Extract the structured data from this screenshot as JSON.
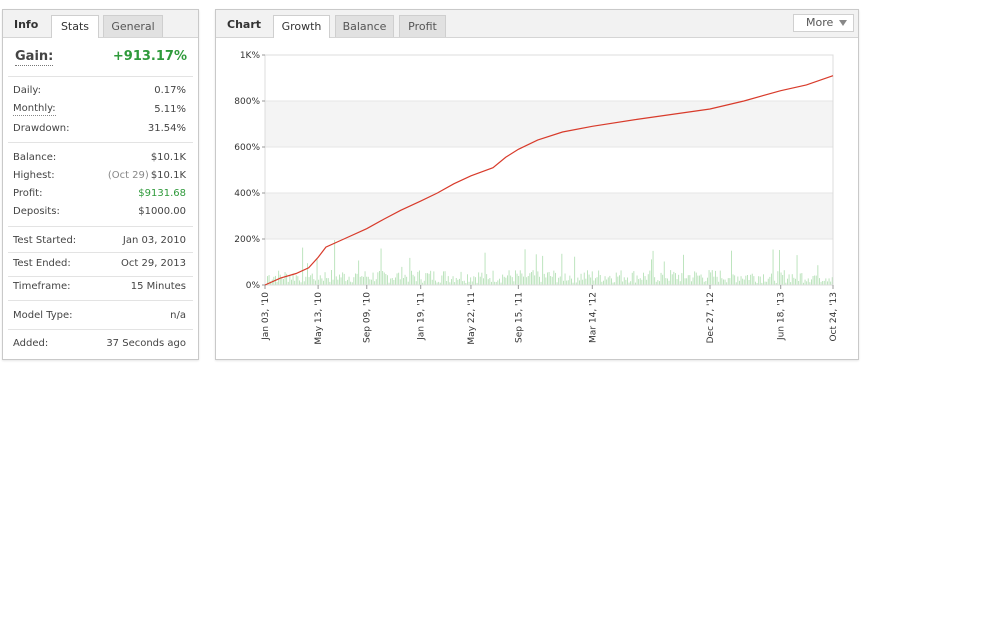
{
  "info": {
    "title": "Info",
    "tabs": [
      {
        "label": "Stats",
        "active": true
      },
      {
        "label": "General",
        "active": false
      }
    ],
    "gain": {
      "label": "Gain:",
      "value": "+913.17%"
    },
    "rows": {
      "daily": {
        "label": "Daily:",
        "value": "0.17%"
      },
      "monthly": {
        "label": "Monthly:",
        "value": "5.11%"
      },
      "drawdown": {
        "label": "Drawdown:",
        "value": "31.54%"
      },
      "balance": {
        "label": "Balance:",
        "value": "$10.1K"
      },
      "highest": {
        "label": "Highest:",
        "date": "(Oct 29)",
        "value": "$10.1K"
      },
      "profit": {
        "label": "Profit:",
        "value": "$9131.68"
      },
      "deposits": {
        "label": "Deposits:",
        "value": "$1000.00"
      },
      "test_started": {
        "label": "Test Started:",
        "value": "Jan 03, 2010"
      },
      "test_ended": {
        "label": "Test Ended:",
        "value": "Oct 29, 2013"
      },
      "timeframe": {
        "label": "Timeframe:",
        "value": "15 Minutes"
      },
      "model_type": {
        "label": "Model Type:",
        "value": "n/a"
      },
      "added": {
        "label": "Added:",
        "value": "37 Seconds ago"
      }
    }
  },
  "chart": {
    "title": "Chart",
    "tabs": [
      {
        "label": "Growth",
        "active": true
      },
      {
        "label": "Balance",
        "active": false
      },
      {
        "label": "Profit",
        "active": false
      }
    ],
    "more_label": "More"
  },
  "colors": {
    "gain_green": "#2f9a3b",
    "line_red": "#d83b2b",
    "bar_green": "#a9dcaa",
    "band_gray": "#f4f4f4"
  },
  "chart_data": {
    "type": "line",
    "y_tick_labels": [
      "0%",
      "200%",
      "400%",
      "600%",
      "800%",
      "1K%"
    ],
    "ylim": [
      0,
      1000
    ],
    "x_tick_labels": [
      "Jan 03, '10",
      "May 13, '10",
      "Sep 09, '10",
      "Jan 19, '11",
      "May 22, '11",
      "Sep 15, '11",
      "Mar 14, '12",
      "Dec 27, '12",
      "Jun 18, '13",
      "Oct 24, '13"
    ],
    "series": [
      {
        "values": [
          {
            "x": "Jan 03, '10",
            "y": 0
          },
          {
            "x": "Feb 10, '10",
            "y": 30
          },
          {
            "x": "Mar 20, '10",
            "y": 50
          },
          {
            "x": "Apr 20, '10",
            "y": 75
          },
          {
            "x": "May 13, '10",
            "y": 120
          },
          {
            "x": "Jun 01, '10",
            "y": 165
          },
          {
            "x": "Jul 15, '10",
            "y": 200
          },
          {
            "x": "Sep 09, '10",
            "y": 245
          },
          {
            "x": "Oct 20, '10",
            "y": 285
          },
          {
            "x": "Dec 01, '10",
            "y": 325
          },
          {
            "x": "Jan 19, '11",
            "y": 365
          },
          {
            "x": "Mar 01, '11",
            "y": 400
          },
          {
            "x": "Apr 10, '11",
            "y": 440
          },
          {
            "x": "May 22, '11",
            "y": 475
          },
          {
            "x": "Jul 15, '11",
            "y": 510
          },
          {
            "x": "Aug 15, '11",
            "y": 555
          },
          {
            "x": "Sep 15, '11",
            "y": 590
          },
          {
            "x": "Nov 01, '11",
            "y": 630
          },
          {
            "x": "Jan 01, '12",
            "y": 665
          },
          {
            "x": "Mar 14, '12",
            "y": 690
          },
          {
            "x": "Jul 01, '12",
            "y": 720
          },
          {
            "x": "Dec 27, '12",
            "y": 765
          },
          {
            "x": "Mar 20, '13",
            "y": 800
          },
          {
            "x": "Jun 18, '13",
            "y": 845
          },
          {
            "x": "Aug 20, '13",
            "y": 870
          },
          {
            "x": "Oct 24, '13",
            "y": 910
          }
        ]
      }
    ],
    "background_bars": "green daily-activity bars along the bottom",
    "grid": true
  }
}
